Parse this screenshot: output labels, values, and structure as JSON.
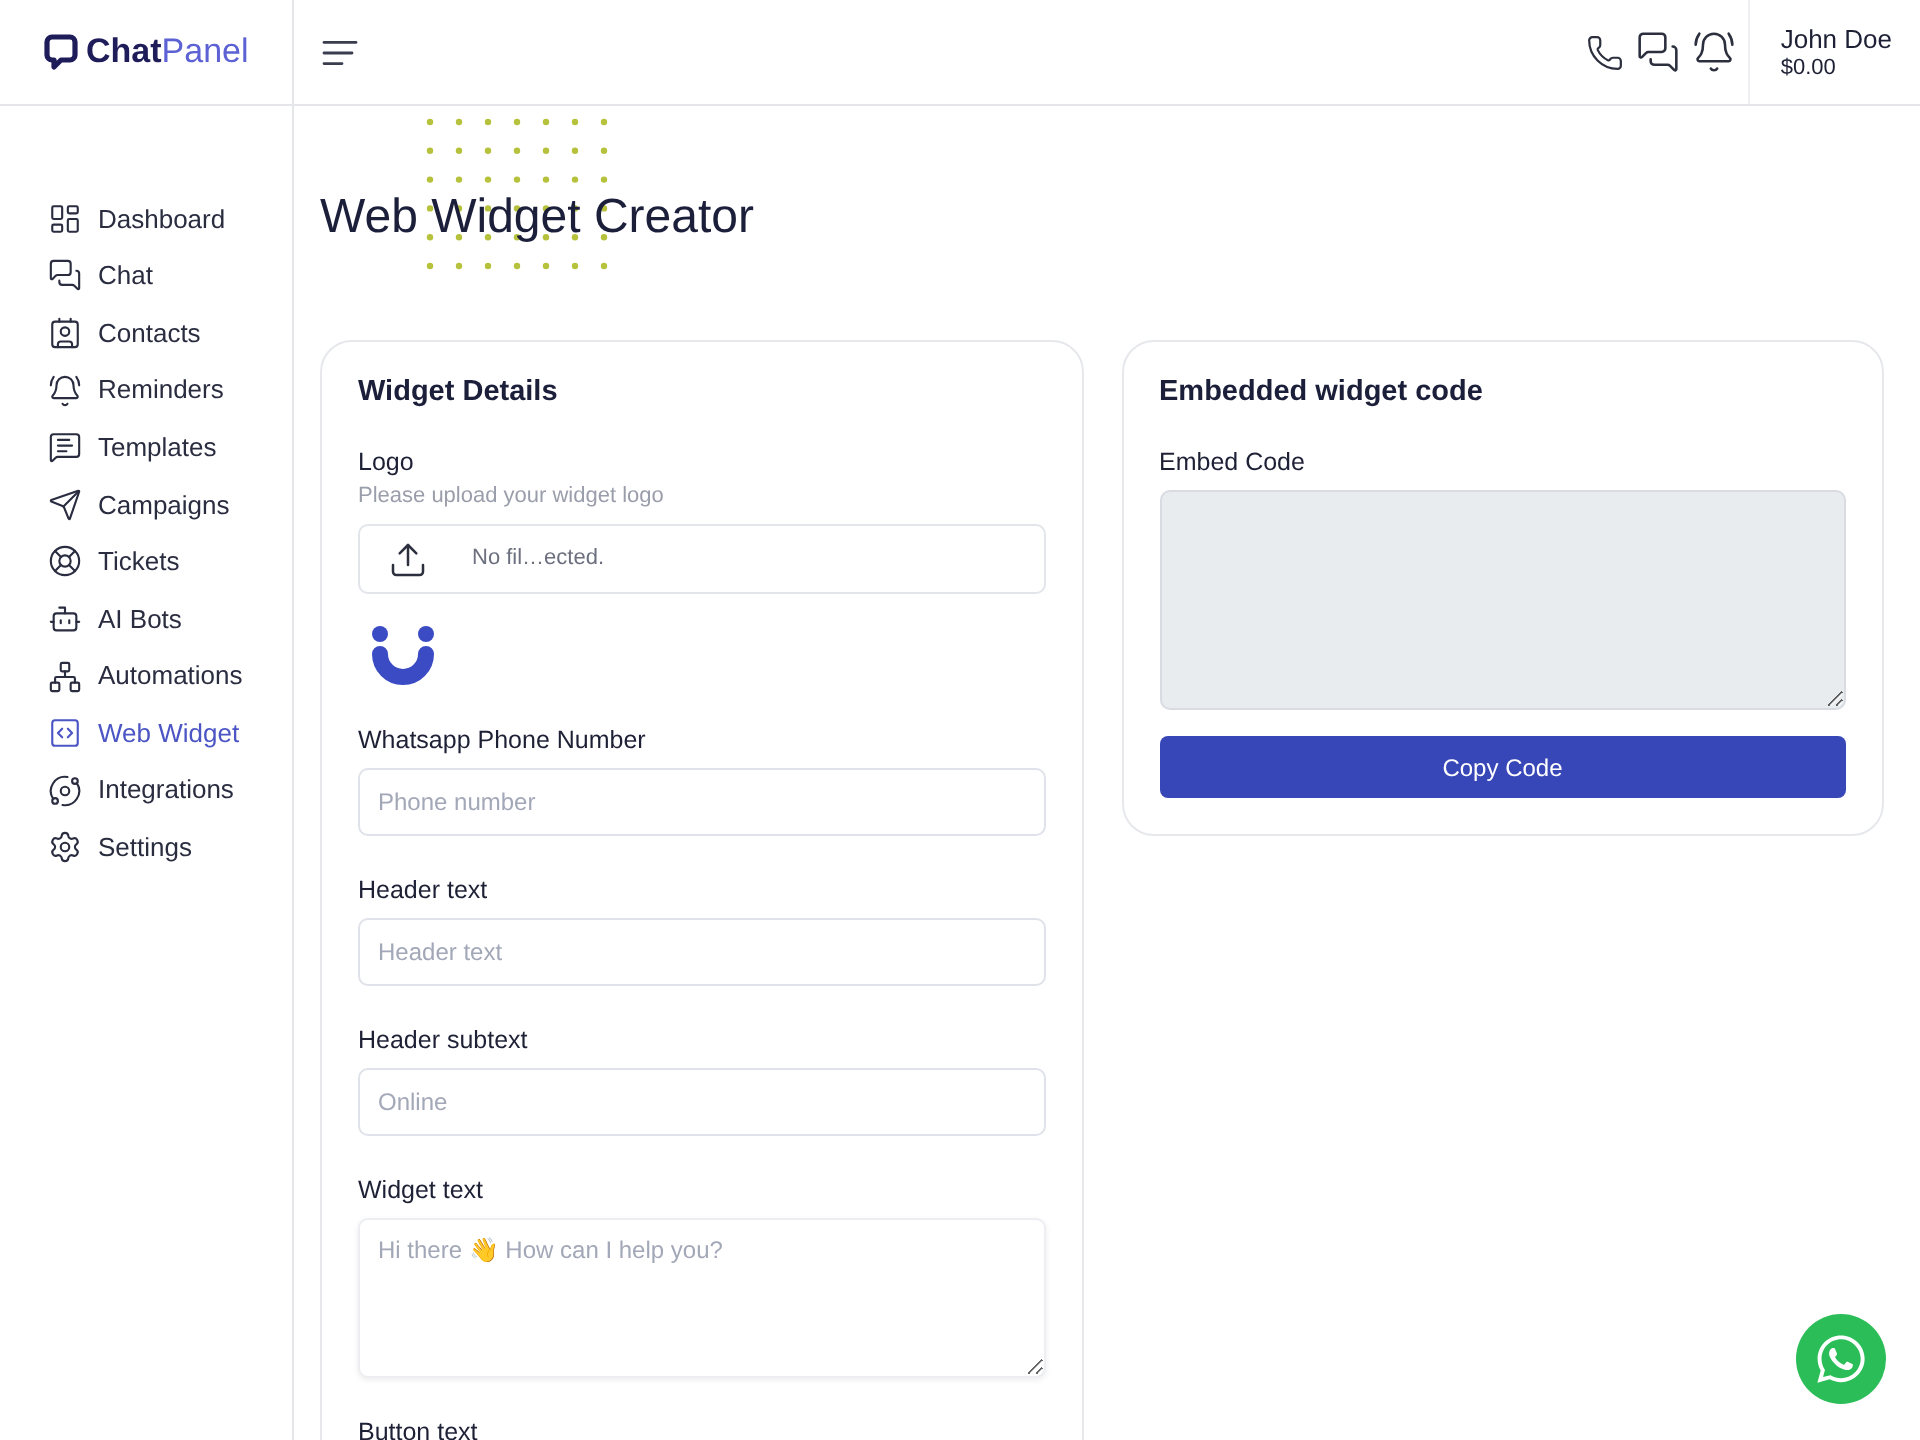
{
  "header": {
    "logo": "**Chat**Panel",
    "user": {
      "name": "John Doe",
      "balance": "$0.00"
    }
  },
  "sidebar": {
    "items": [
      {
        "label": "Dashboard",
        "selected": false
      },
      {
        "label": "Chat",
        "selected": false
      },
      {
        "label": "Contacts",
        "selected": false
      },
      {
        "label": "Reminders",
        "selected": false
      },
      {
        "label": "Templates",
        "selected": false
      },
      {
        "label": "Campaigns",
        "selected": false
      },
      {
        "label": "Tickets",
        "selected": false
      },
      {
        "label": "AI Bots",
        "selected": false
      },
      {
        "label": "Automations",
        "selected": false
      },
      {
        "label": "Web Widget",
        "selected": true
      },
      {
        "label": "Integrations",
        "selected": false
      },
      {
        "label": "Settings",
        "selected": false
      }
    ]
  },
  "page": {
    "title": "Web Widget Creator"
  },
  "widget_details": {
    "title": "Widget Details",
    "logo": {
      "label": "Logo",
      "hint": "Please upload your widget logo",
      "file_status": "No fil…ected."
    },
    "fields": [
      {
        "kind": "input",
        "label": "Whatsapp Phone Number",
        "placeholder": "Phone number"
      },
      {
        "kind": "input",
        "label": "Header text",
        "placeholder": "Header text"
      },
      {
        "kind": "input",
        "label": "Header subtext",
        "placeholder": "Online"
      },
      {
        "kind": "textarea",
        "label": "Widget text",
        "placeholder": "Hi there 👋 How can I help you?"
      },
      {
        "kind": "label",
        "label": "Button text"
      }
    ]
  },
  "embed": {
    "title": "Embedded widget code",
    "label": "Embed Code",
    "button": "Copy Code"
  }
}
